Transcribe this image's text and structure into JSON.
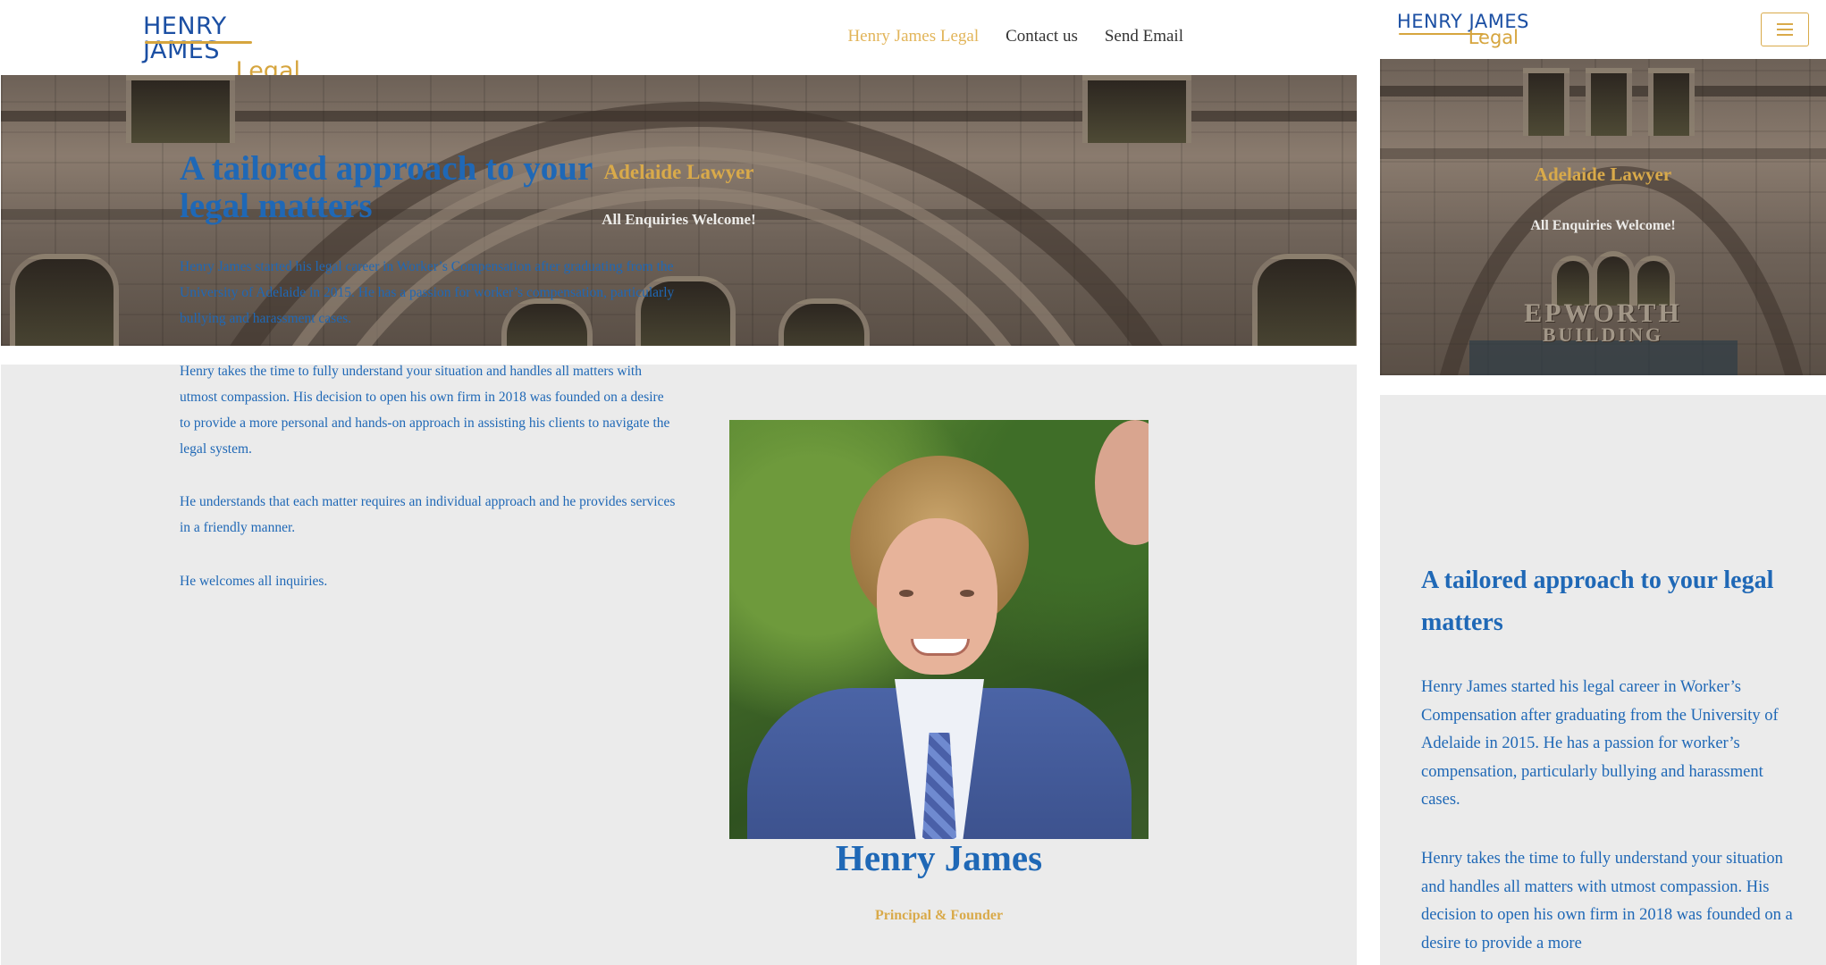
{
  "brand": {
    "line1": "HENRY JAMES",
    "line2": "Legal"
  },
  "nav": {
    "items": [
      {
        "label": "Henry James Legal",
        "active": true
      },
      {
        "label": "Contact us",
        "active": false
      },
      {
        "label": "Send Email",
        "active": false
      }
    ]
  },
  "hero": {
    "title": "Adelaide Lawyer",
    "subtitle": "All Enquiries Welcome!",
    "building_sign_line1": "EPWORTH",
    "building_sign_line2": "BUILDING"
  },
  "about": {
    "heading": "A tailored approach to your legal matters",
    "paragraphs": [
      "Henry James started his legal career in Worker’s Compensation after graduating from the University of Adelaide in 2015. He has a passion for worker’s compensation, particularly bullying and harassment cases.",
      "Henry takes the time to fully understand your situation and handles all matters with utmost compassion. His decision to open his own firm in 2018 was founded on a desire to provide a more personal and hands-on approach in assisting his clients to navigate the legal system.",
      "He understands that each matter requires an individual approach and he provides services in a friendly manner.",
      "He welcomes all inquiries."
    ],
    "mobile_paragraph_2_visible": "Henry takes the time to fully understand your situation and handles all matters with utmost compassion. His decision to open his own firm in 2018 was founded on a desire to provide a more"
  },
  "profile": {
    "name": "Henry James",
    "role": "Principal & Founder"
  },
  "colors": {
    "primary_blue": "#1f68b6",
    "accent_gold": "#d9aa4a",
    "panel_grey": "#ebebeb"
  },
  "icons": {
    "menu": "hamburger-menu-icon"
  }
}
